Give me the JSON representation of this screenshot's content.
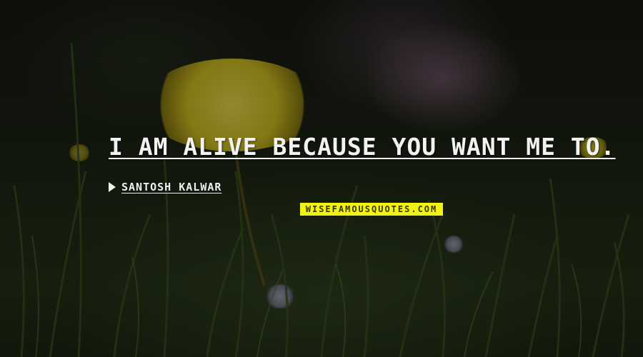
{
  "quote": {
    "text": "I am alive because you want me to."
  },
  "author": {
    "name": "Santosh Kalwar",
    "icon": "play-arrow-icon"
  },
  "watermark": {
    "text": "WISEFAMOUSQUOTES.COM",
    "background_color": "#f2f213"
  },
  "colors": {
    "text": "#f2f2f2",
    "flower_yellow": "#e6d52a",
    "background_pink_blossom": "#9a7592",
    "grass_green": "#2c3a18"
  }
}
